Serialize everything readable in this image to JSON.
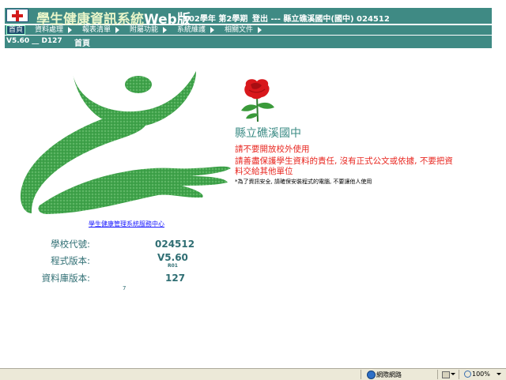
{
  "header": {
    "title_main": "學生健康資訊系統",
    "title_web": "Web版",
    "term": "102學年 第2學期",
    "login": "登出 --- 縣立礁溪國中(國中) 024512"
  },
  "menu": {
    "items": [
      {
        "label": "首頁"
      },
      {
        "label": "資料處理"
      },
      {
        "label": "報表清單"
      },
      {
        "label": "附屬功能"
      },
      {
        "label": "系統維護"
      },
      {
        "label": "相關文件"
      }
    ]
  },
  "subbar": {
    "version": "V5.60 __ D127",
    "home": "首頁"
  },
  "welcome": {
    "school_name": "縣立礁溪國中",
    "warning_1": "請不要開放校外使用",
    "warning_2": "請善盡保護學生資料的責任, 沒有正式公文或依據, 不要把資",
    "warning_3": "料交給其他單位",
    "note": "*為了資訊安全, 請確保安裝程式的電腦, 不要讓他人使用"
  },
  "info": {
    "service_link": "學生健康管理系統服務中心",
    "school_code_label": "學校代號:",
    "school_code": "024512",
    "program_version_label": "程式版本:",
    "program_version": "V5.60",
    "program_build": "R01",
    "db_version_label": "資料庫版本:",
    "db_version": "127",
    "db_extra": "7"
  },
  "statusbar": {
    "zone": "網際網路",
    "zoom": "100%"
  },
  "colors": {
    "header_bg": "#3f8a84",
    "accent_text": "#2f6e73",
    "warning": "#e8261f",
    "emblem_green": "#3fa34a"
  },
  "icons": {
    "logo": "red-cross-icon",
    "emblem": "health-emblem-icon",
    "rose": "rose-icon",
    "zone": "globe-icon",
    "zoom": "zoom-icon"
  }
}
